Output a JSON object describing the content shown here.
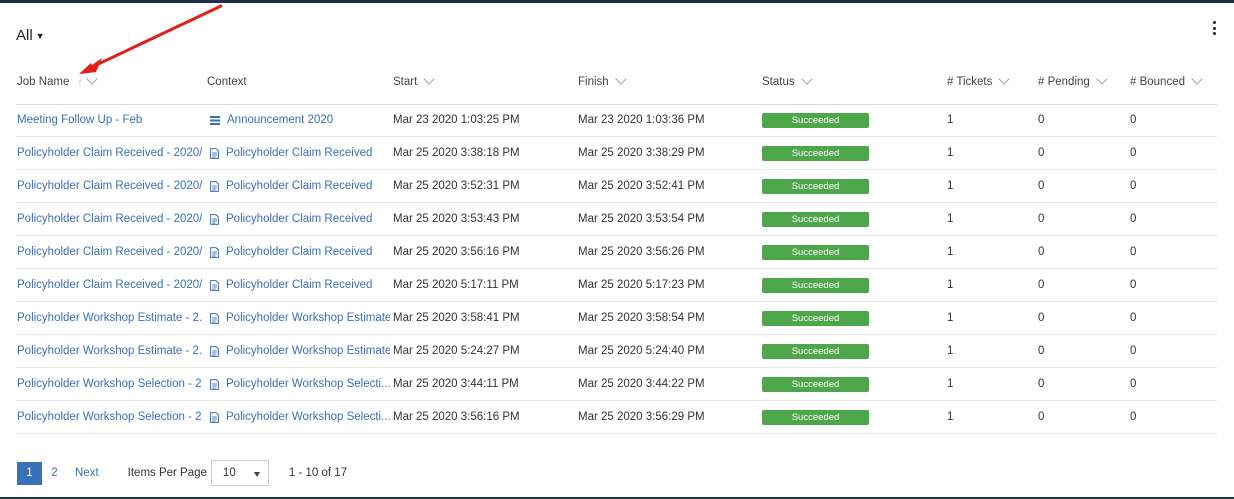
{
  "filter": {
    "label": "All"
  },
  "columns": {
    "job_name": "Job Name",
    "context": "Context",
    "start": "Start",
    "finish": "Finish",
    "status": "Status",
    "tickets": "# Tickets",
    "pending": "# Pending",
    "bounced": "# Bounced"
  },
  "rows": [
    {
      "job_name": "Meeting Follow Up - Feb",
      "context_icon": "list-icon",
      "context": "Announcement 2020",
      "start": "Mar 23 2020 1:03:25 PM",
      "finish": "Mar 23 2020 1:03:36 PM",
      "status": "Succeeded",
      "tickets": "1",
      "pending": "0",
      "bounced": "0"
    },
    {
      "job_name": "Policyholder Claim Received - 2020/...",
      "context_icon": "document-icon",
      "context": "Policyholder Claim Received",
      "start": "Mar 25 2020 3:38:18 PM",
      "finish": "Mar 25 2020 3:38:29 PM",
      "status": "Succeeded",
      "tickets": "1",
      "pending": "0",
      "bounced": "0"
    },
    {
      "job_name": "Policyholder Claim Received - 2020/...",
      "context_icon": "document-icon",
      "context": "Policyholder Claim Received",
      "start": "Mar 25 2020 3:52:31 PM",
      "finish": "Mar 25 2020 3:52:41 PM",
      "status": "Succeeded",
      "tickets": "1",
      "pending": "0",
      "bounced": "0"
    },
    {
      "job_name": "Policyholder Claim Received - 2020/...",
      "context_icon": "document-icon",
      "context": "Policyholder Claim Received",
      "start": "Mar 25 2020 3:53:43 PM",
      "finish": "Mar 25 2020 3:53:54 PM",
      "status": "Succeeded",
      "tickets": "1",
      "pending": "0",
      "bounced": "0"
    },
    {
      "job_name": "Policyholder Claim Received - 2020/...",
      "context_icon": "document-icon",
      "context": "Policyholder Claim Received",
      "start": "Mar 25 2020 3:56:16 PM",
      "finish": "Mar 25 2020 3:56:26 PM",
      "status": "Succeeded",
      "tickets": "1",
      "pending": "0",
      "bounced": "0"
    },
    {
      "job_name": "Policyholder Claim Received - 2020/...",
      "context_icon": "document-icon",
      "context": "Policyholder Claim Received",
      "start": "Mar 25 2020 5:17:11 PM",
      "finish": "Mar 25 2020 5:17:23 PM",
      "status": "Succeeded",
      "tickets": "1",
      "pending": "0",
      "bounced": "0"
    },
    {
      "job_name": "Policyholder Workshop Estimate - 2...",
      "context_icon": "document-icon",
      "context": "Policyholder Workshop Estimate",
      "start": "Mar 25 2020 3:58:41 PM",
      "finish": "Mar 25 2020 3:58:54 PM",
      "status": "Succeeded",
      "tickets": "1",
      "pending": "0",
      "bounced": "0"
    },
    {
      "job_name": "Policyholder Workshop Estimate - 2...",
      "context_icon": "document-icon",
      "context": "Policyholder Workshop Estimate",
      "start": "Mar 25 2020 5:24:27 PM",
      "finish": "Mar 25 2020 5:24:40 PM",
      "status": "Succeeded",
      "tickets": "1",
      "pending": "0",
      "bounced": "0"
    },
    {
      "job_name": "Policyholder Workshop Selection - 2...",
      "context_icon": "document-icon",
      "context": "Policyholder Workshop Selecti...",
      "start": "Mar 25 2020 3:44:11 PM",
      "finish": "Mar 25 2020 3:44:22 PM",
      "status": "Succeeded",
      "tickets": "1",
      "pending": "0",
      "bounced": "0"
    },
    {
      "job_name": "Policyholder Workshop Selection - 2...",
      "context_icon": "document-icon",
      "context": "Policyholder Workshop Selecti...",
      "start": "Mar 25 2020 3:56:16 PM",
      "finish": "Mar 25 2020 3:56:29 PM",
      "status": "Succeeded",
      "tickets": "1",
      "pending": "0",
      "bounced": "0"
    }
  ],
  "pagination": {
    "pages": [
      "1",
      "2"
    ],
    "current": "1",
    "next_label": "Next",
    "items_per_page_label": "Items Per Page",
    "items_per_page_value": "10",
    "range_label": "1 - 10 of 17"
  },
  "colors": {
    "link": "#3a70b6",
    "status_succeeded": "#4ea64a",
    "annotation_arrow": "#e0201b",
    "top_bar": "#1f3146"
  }
}
